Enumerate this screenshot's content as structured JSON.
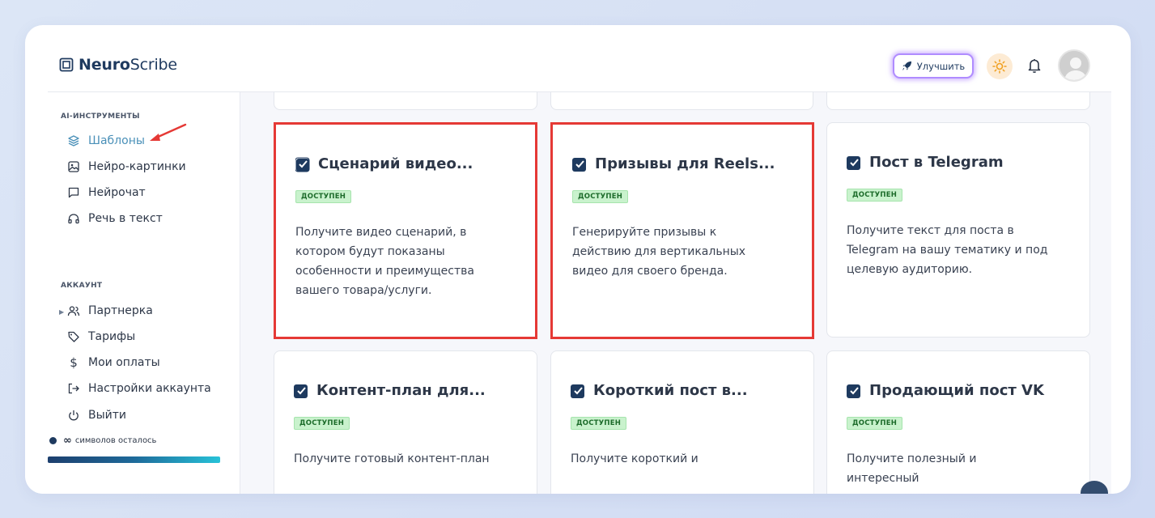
{
  "header": {
    "logo_bold": "Neuro",
    "logo_rest": "Scribe",
    "upgrade_label": "Улучшить"
  },
  "sidebar": {
    "section_ai": "AI-ИНСТРУМЕНТЫ",
    "ai_items": [
      {
        "label": "Шаблоны",
        "icon": "layers-icon",
        "active": true
      },
      {
        "label": "Нейро-картинки",
        "icon": "image-icon"
      },
      {
        "label": "Нейрочат",
        "icon": "chat-icon"
      },
      {
        "label": "Речь в текст",
        "icon": "headphones-icon"
      }
    ],
    "section_account": "АККАУНТ",
    "account_items": [
      {
        "label": "Партнерка",
        "icon": "users-icon"
      },
      {
        "label": "Тарифы",
        "icon": "tag-icon"
      },
      {
        "label": "Мои оплаты",
        "icon": "dollar-icon"
      },
      {
        "label": "Настройки аккаунта",
        "icon": "logout-arrow-icon"
      },
      {
        "label": "Выйти",
        "icon": "power-icon"
      }
    ],
    "symbols_value": "∞",
    "symbols_label": "символов осталось"
  },
  "cards": [
    {
      "title": "Сценарий видео...",
      "badge": "ДОСТУПЕН",
      "desc": "Получите видео сценарий, в котором будут показаны особенности и преимущества вашего товара/услуги."
    },
    {
      "title": "Призывы для Reels...",
      "badge": "ДОСТУПЕН",
      "desc": "Генерируйте призывы к действию для вертикальных видео для своего бренда."
    },
    {
      "title": "Пост в Telegram",
      "badge": "ДОСТУПЕН",
      "desc": "Получите текст для поста в Telegram на вашу тематику и под целевую аудиторию."
    },
    {
      "title": "Контент-план для...",
      "badge": "ДОСТУПЕН",
      "desc": "Получите готовый контент-план"
    },
    {
      "title": "Короткий пост в...",
      "badge": "ДОСТУПЕН",
      "desc": "Получите короткий и"
    },
    {
      "title": "Продающий пост VK",
      "badge": "ДОСТУПЕН",
      "desc": "Получите полезный и интересный"
    }
  ],
  "colors": {
    "highlight": "#e53935",
    "active_nav": "#4a90b8",
    "brand": "#1e3a5f"
  }
}
